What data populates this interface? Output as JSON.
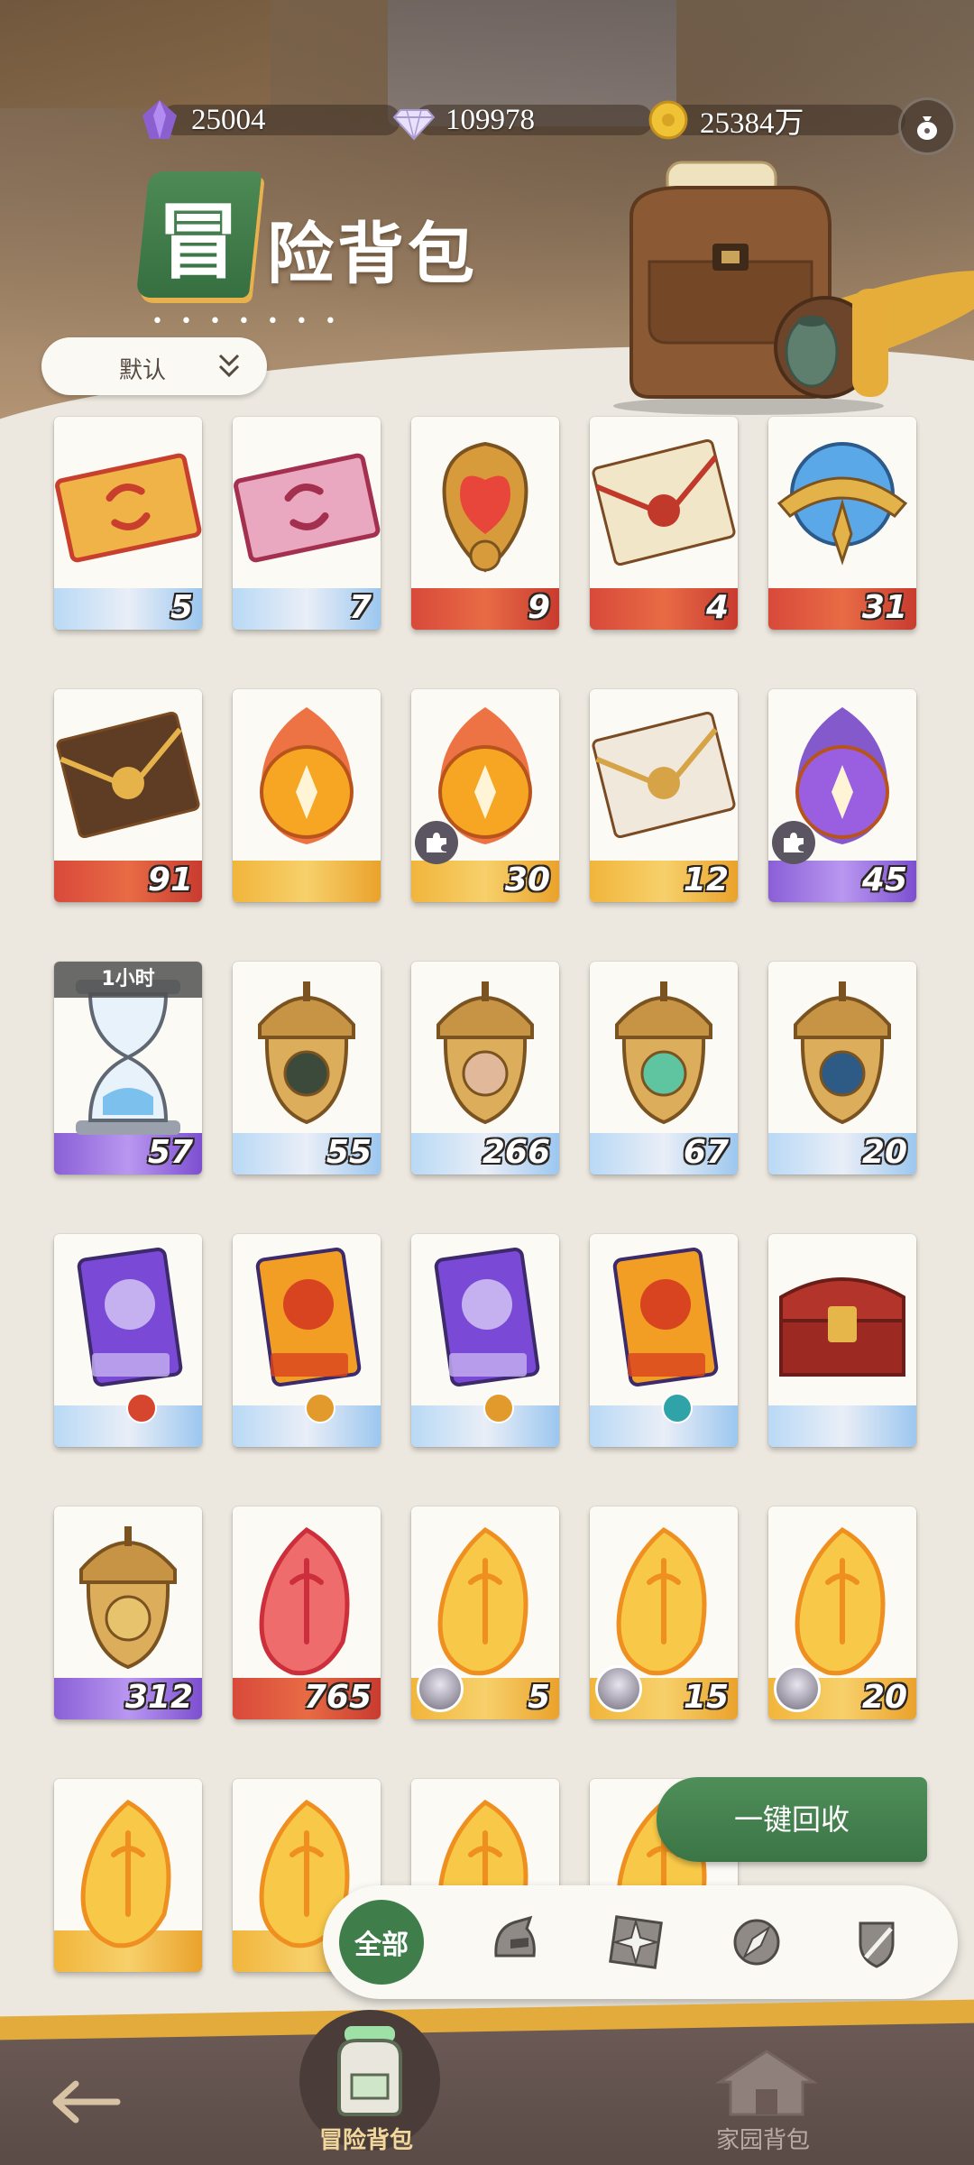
{
  "currencies": [
    {
      "name": "purple-crystal",
      "value": "25004",
      "color": "#8b5fd0"
    },
    {
      "name": "diamond",
      "value": "109978",
      "color": "#d9cdf5"
    },
    {
      "name": "gold-coin",
      "value": "25384万",
      "color": "#e8b82a"
    }
  ],
  "title": {
    "badge_char": "冒",
    "rest": "险背包",
    "dots": "• • • • • • •"
  },
  "sort": {
    "selected": "默认"
  },
  "items": [
    {
      "count": "5",
      "icon": "ticket-icon",
      "band": "blue"
    },
    {
      "count": "7",
      "icon": "ticket-pink-icon",
      "band": "blue"
    },
    {
      "count": "9",
      "icon": "heart-amulet-icon",
      "band": "red"
    },
    {
      "count": "4",
      "icon": "red-envelope-icon",
      "band": "red"
    },
    {
      "count": "31",
      "icon": "crystal-orb-icon",
      "band": "red"
    },
    {
      "count": "91",
      "icon": "brown-envelope-icon",
      "band": "red"
    },
    {
      "count": "",
      "icon": "fire-coin-icon",
      "band": "gold"
    },
    {
      "count": "30",
      "icon": "fire-trident-icon",
      "band": "gold",
      "puzzle": true
    },
    {
      "count": "12",
      "icon": "white-envelope-icon",
      "band": "gold"
    },
    {
      "count": "45",
      "icon": "purple-flame-icon",
      "band": "purple",
      "puzzle": true
    },
    {
      "count": "57",
      "icon": "hourglass-icon",
      "band": "purple",
      "timer": "1小时"
    },
    {
      "count": "55",
      "icon": "acorn-eye-icon",
      "band": "blue"
    },
    {
      "count": "266",
      "icon": "acorn-target-icon",
      "band": "blue"
    },
    {
      "count": "67",
      "icon": "acorn-leaf-icon",
      "band": "blue"
    },
    {
      "count": "20",
      "icon": "acorn-star-icon",
      "band": "blue"
    },
    {
      "count": "",
      "icon": "purple-card-icon",
      "band": "blue",
      "mini": "#d6462f"
    },
    {
      "count": "",
      "icon": "orange-card-icon",
      "band": "blue",
      "mini": "#e29a2c"
    },
    {
      "count": "",
      "icon": "purple-card-icon",
      "band": "blue",
      "mini": "#e29a2c"
    },
    {
      "count": "",
      "icon": "orange-card-icon",
      "band": "blue",
      "mini": "#2fa3a7"
    },
    {
      "count": "",
      "icon": "treasure-chest-icon",
      "band": "blue"
    },
    {
      "count": "312",
      "icon": "acorn-diamond-icon",
      "band": "purple"
    },
    {
      "count": "765",
      "icon": "red-seed-icon",
      "band": "red"
    },
    {
      "count": "5",
      "icon": "gold-seed-icon",
      "band": "gold",
      "avatar": true
    },
    {
      "count": "15",
      "icon": "gold-seed-icon",
      "band": "gold",
      "avatar": true
    },
    {
      "count": "20",
      "icon": "gold-seed-icon",
      "band": "gold",
      "avatar": true
    },
    {
      "count": "",
      "icon": "gold-seed-icon",
      "band": "gold"
    },
    {
      "count": "",
      "icon": "gold-seed-icon",
      "band": "gold"
    },
    {
      "count": "",
      "icon": "gold-seed-icon",
      "band": "gold"
    },
    {
      "count": "",
      "icon": "gold-seed-icon",
      "band": "gold"
    }
  ],
  "recycle_button": "一键回收",
  "filter": {
    "all": "全部",
    "icons": [
      "helmet-icon",
      "compass-star-icon",
      "compass-icon",
      "sword-shield-icon"
    ]
  },
  "nav": {
    "adventure": "冒险背包",
    "home": "家园背包"
  },
  "colors": {
    "accent_green": "#3f7e4a",
    "accent_gold": "#e3aa3c"
  }
}
